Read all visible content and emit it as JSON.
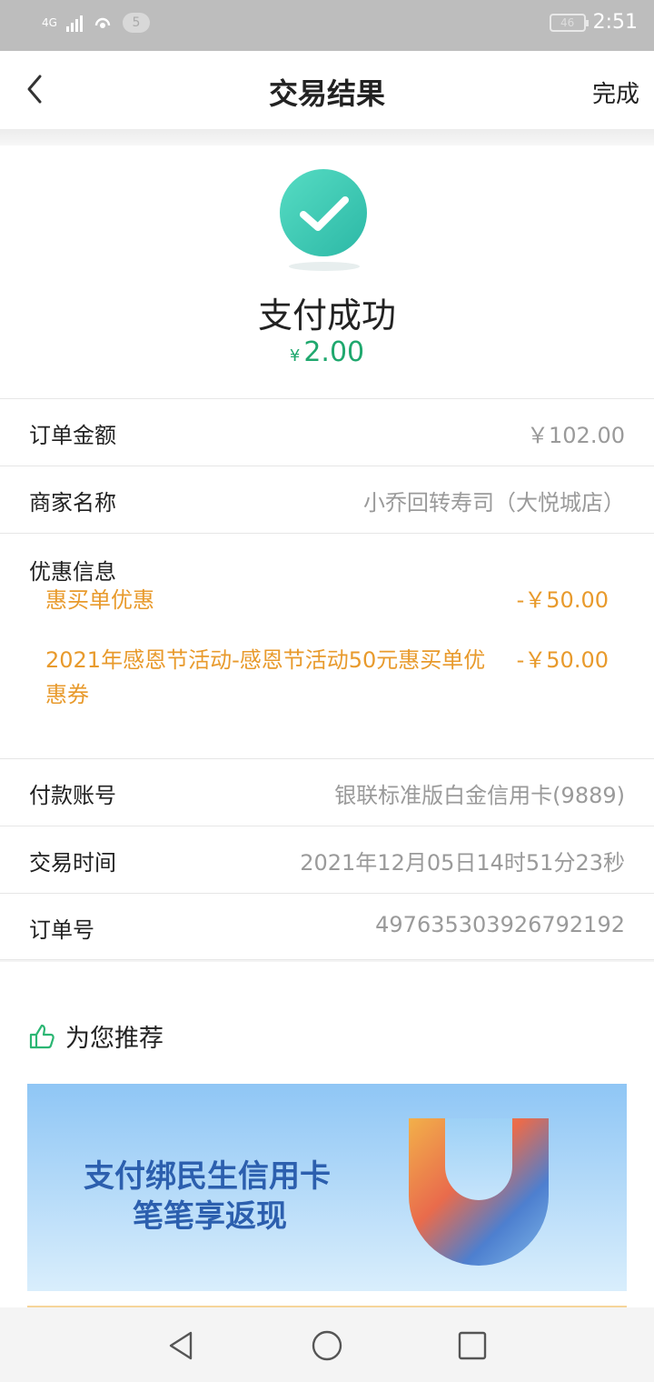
{
  "status_bar": {
    "network_type": "4G",
    "notification_count": "5",
    "battery_level": "46",
    "time": "2:51"
  },
  "header": {
    "title": "交易结果",
    "done_label": "完成"
  },
  "result": {
    "status_text": "支付成功",
    "currency_symbol": "¥",
    "amount": "2.00",
    "accent_color": "#1fa86e"
  },
  "details": {
    "order_amount": {
      "label": "订单金额",
      "value": "￥102.00"
    },
    "merchant": {
      "label": "商家名称",
      "value": "小乔回转寿司（大悦城店）"
    },
    "discounts": {
      "label": "优惠信息",
      "items": [
        {
          "name": "惠买单优惠",
          "amount": "-￥50.00"
        },
        {
          "name": "2021年感恩节活动-感恩节活动50元惠买单优惠券",
          "amount": "-￥50.00"
        }
      ],
      "color": "#e89a2c"
    },
    "account": {
      "label": "付款账号",
      "value": "银联标准版白金信用卡(9889)"
    },
    "time": {
      "label": "交易时间",
      "value": "2021年12月05日14时51分23秒"
    },
    "order_no": {
      "label": "订单号",
      "value": "497635303926792192"
    }
  },
  "recommend": {
    "title": "为您推荐",
    "banner_line1": "支付绑民生信用卡",
    "banner_line2": "笔笔享返现"
  },
  "icons": {
    "back": "chevron-left-icon",
    "success": "checkmark-circle-icon",
    "recommend": "thumbs-up-icon",
    "sys_back": "triangle-back-icon",
    "sys_home": "circle-home-icon",
    "sys_recent": "square-recent-icon"
  }
}
